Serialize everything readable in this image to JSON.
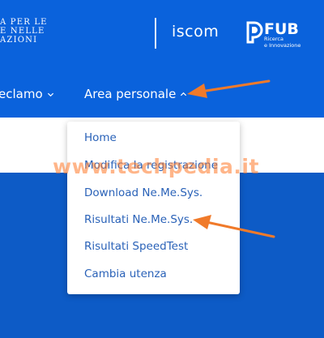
{
  "header": {
    "ministry_text": "A PER LE\nE NELLE\nAZIONI",
    "iscom_logo": "iscom",
    "fub_name": "FUB",
    "fub_tagline": "Ricerca\ne Innovazione"
  },
  "nav": {
    "reclamo_label": "eclamo",
    "area_label": "Area personale"
  },
  "dropdown": {
    "items": [
      "Home",
      "Modifica la registrazione",
      "Download Ne.Me.Sys.",
      "Risultati Ne.Me.Sys.",
      "Risultati SpeedTest",
      "Cambia utenza"
    ]
  },
  "watermark": "www.techpedia.it",
  "colors": {
    "header_blue": "#0a62dc",
    "lower_blue": "#0d5bc6",
    "menu_text": "#2a62b8",
    "annotation_arrow": "#f07a2a"
  },
  "icons": {
    "reclamo_chevron": "chevron-down-icon",
    "area_chevron": "chevron-up-icon",
    "fub_logo": "fub-logo-icon"
  }
}
